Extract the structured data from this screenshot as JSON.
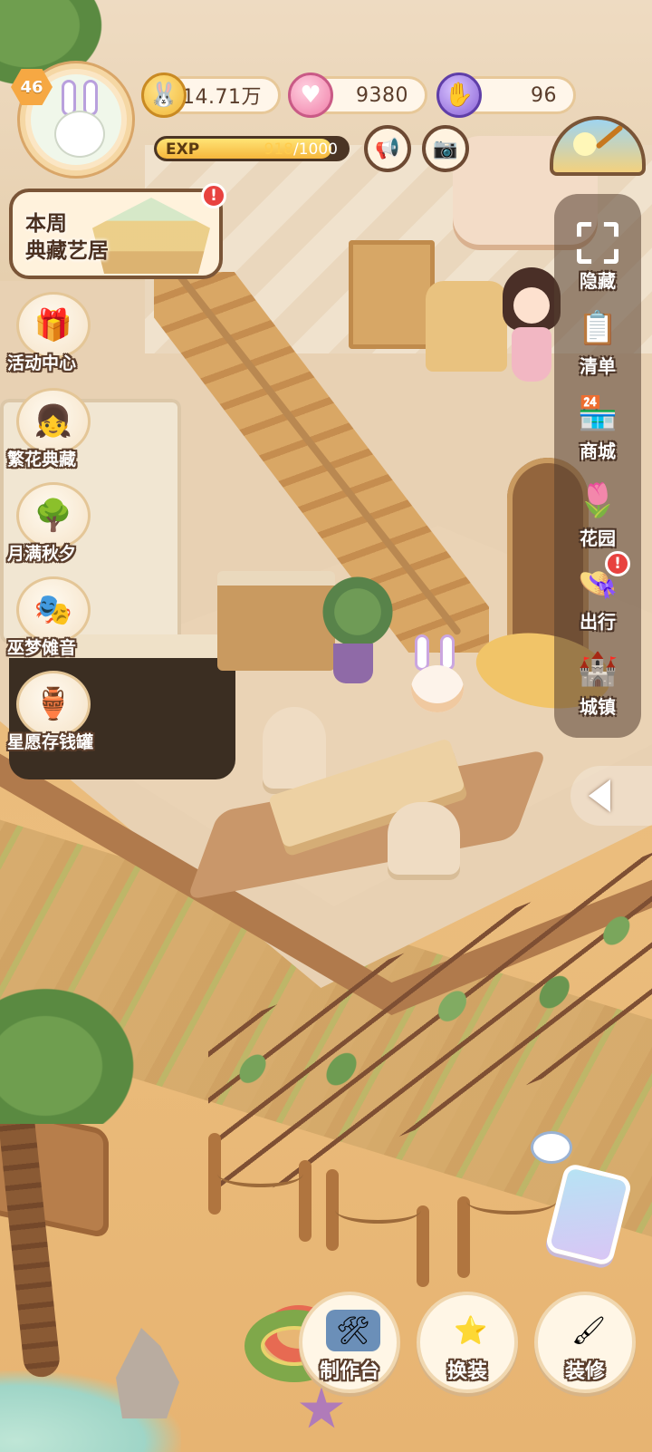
{
  "player": {
    "level": "46",
    "avatar_icon": "bunny-avatar-icon"
  },
  "resources": {
    "coins": "14.71万",
    "hearts": "9380",
    "energy": "96",
    "coin_icon": "bunny-coin-icon",
    "heart_icon": "pink-heart-icon",
    "energy_icon": "purple-glove-icon"
  },
  "exp": {
    "label": "EXP",
    "current": "918",
    "separator_max": "/1000",
    "progress": 0.918
  },
  "top_buttons": {
    "announcement_icon": "megaphone-icon",
    "camera_icon": "camera-icon",
    "weather_icon": "weather-gauge-icon"
  },
  "weekly_banner": {
    "line1": "本周",
    "line2": "典藏艺居",
    "alert": "!"
  },
  "left_menu": [
    {
      "label": "活动中心",
      "icon": "gift-box-icon"
    },
    {
      "label": "繁花典藏",
      "icon": "flower-girl-icon"
    },
    {
      "label": "月满秋夕",
      "icon": "golden-tree-icon"
    },
    {
      "label": "巫梦傩音",
      "icon": "mask-icon"
    },
    {
      "label": "星愿存钱罐",
      "icon": "wish-jar-icon"
    }
  ],
  "right_menu": [
    {
      "label": "隐藏",
      "icon": "hide-frame-icon"
    },
    {
      "label": "清单",
      "icon": "checklist-icon"
    },
    {
      "label": "商城",
      "icon": "shop-icon"
    },
    {
      "label": "花园",
      "icon": "garden-icon"
    },
    {
      "label": "出行",
      "icon": "travel-hat-icon",
      "alert": "!"
    },
    {
      "label": "城镇",
      "icon": "castle-icon"
    }
  ],
  "bottom_menu": [
    {
      "label": "制作台",
      "icon": "workbench-icon"
    },
    {
      "label": "换装",
      "icon": "outfit-star-icon"
    },
    {
      "label": "装修",
      "icon": "paint-roller-icon"
    }
  ],
  "colors": {
    "outline": "#5a3d2b",
    "alert_red": "#e8423f",
    "exp_fill": "#f6b63c",
    "panel": "#533e30"
  }
}
